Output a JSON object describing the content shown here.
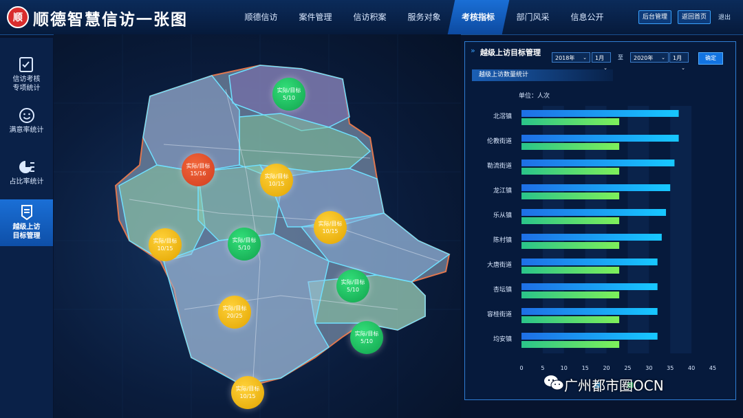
{
  "header": {
    "logo_text": "顺",
    "title": "顺德智慧信访一张图",
    "nav": [
      "顺德信访",
      "案件管理",
      "信访积案",
      "服务对象",
      "考核指标",
      "部门风采",
      "信息公开"
    ],
    "active_nav": "考核指标",
    "admin_label": "后台管理",
    "home_label": "返回首页",
    "logout_label": "退出"
  },
  "sidebar": {
    "items": [
      {
        "label": "信访考核\n专项统计",
        "icon": "checklist-icon"
      },
      {
        "label": "满意率统计",
        "icon": "smile-icon"
      },
      {
        "label": "占比率统计",
        "icon": "pie-icon"
      },
      {
        "label": "越级上访\n目标管理",
        "icon": "document-icon"
      }
    ],
    "active_index": 3
  },
  "map": {
    "pins": [
      {
        "name": "pin-north",
        "label": "实际/目标",
        "value": "5/10",
        "status": "green"
      },
      {
        "name": "pin-northwest",
        "label": "实际/目标",
        "value": "15/16",
        "status": "red"
      },
      {
        "name": "pin-north-center",
        "label": "实际/目标",
        "value": "10/15",
        "status": "yellow"
      },
      {
        "name": "pin-west",
        "label": "实际/目标",
        "value": "10/15",
        "status": "yellow"
      },
      {
        "name": "pin-center",
        "label": "实际/目标",
        "value": "5/10",
        "status": "green"
      },
      {
        "name": "pin-east",
        "label": "实际/目标",
        "value": "10/15",
        "status": "yellow"
      },
      {
        "name": "pin-east-south",
        "label": "实际/目标",
        "value": "5/10",
        "status": "green"
      },
      {
        "name": "pin-south-center",
        "label": "实际/目标",
        "value": "20/25",
        "status": "yellow"
      },
      {
        "name": "pin-southeast",
        "label": "实际/目标",
        "value": "5/10",
        "status": "green"
      },
      {
        "name": "pin-south",
        "label": "实际/目标",
        "value": "10/15",
        "status": "yellow"
      }
    ]
  },
  "panel": {
    "title": "越级上访目标管理",
    "from_year": "2018年",
    "from_month": "1月",
    "separator": "至",
    "to_year": "2020年",
    "to_month": "1月",
    "confirm_label": "确定",
    "subtab": "越级上访数量统计",
    "unit": "单位：人次"
  },
  "chart_data": {
    "type": "bar",
    "orientation": "horizontal",
    "categories": [
      "北滘镇",
      "伦教街道",
      "勒流街道",
      "龙江镇",
      "乐从镇",
      "陈村镇",
      "大唐街道",
      "杏坛镇",
      "容桂街道",
      "均安镇"
    ],
    "series": [
      {
        "name": "",
        "values": [
          37,
          37,
          36,
          35,
          34,
          33,
          32,
          32,
          32,
          32
        ],
        "color": "#1aa8ff"
      },
      {
        "name": "",
        "values": [
          23,
          23,
          23,
          23,
          23,
          23,
          23,
          23,
          23,
          23
        ],
        "color": "#3ee07a"
      }
    ],
    "xlim": [
      0,
      45
    ],
    "xticks": [
      "0",
      "5",
      "10",
      "15",
      "20",
      "25",
      "30",
      "35",
      "40",
      "45"
    ],
    "legend": "bottom"
  },
  "watermark": "广州都市圈OCN"
}
